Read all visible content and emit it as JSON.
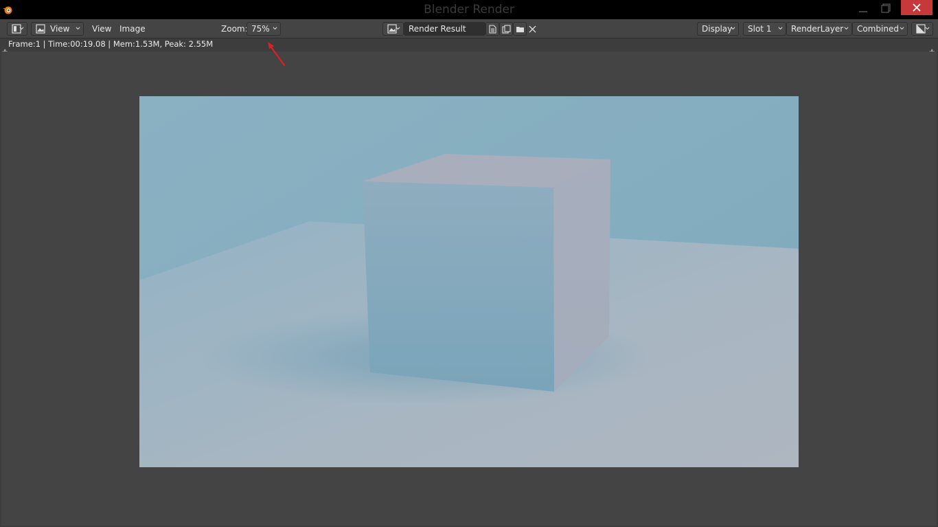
{
  "window": {
    "title": "Blender Render"
  },
  "header": {
    "view_menu_select": "View",
    "menus": [
      "View",
      "Image"
    ],
    "zoom_label": "Zoom:",
    "zoom_value": "75%",
    "image_name": "Render Result",
    "display_label": "Display",
    "slot_label": "Slot 1",
    "render_layer": "RenderLayer",
    "pass": "Combined"
  },
  "info": {
    "status": "Frame:1 | Time:00:19.08 | Mem:1.53M, Peak: 2.55M"
  },
  "colors": {
    "titlebar": "#000000",
    "header": "#444444",
    "close_button": "#c7383b",
    "annotation_arrow": "#e02020",
    "render_sky": "#86aebf",
    "render_floor": "#a9b6c1"
  },
  "icons": {
    "editor_type": "image-editor-icon",
    "image_browse": "image-browse-icon",
    "new_image": "new-image-icon",
    "duplicate": "duplicate-icon",
    "open": "folder-icon",
    "unlink": "close-icon",
    "display_channels": "display-channels-icon"
  }
}
